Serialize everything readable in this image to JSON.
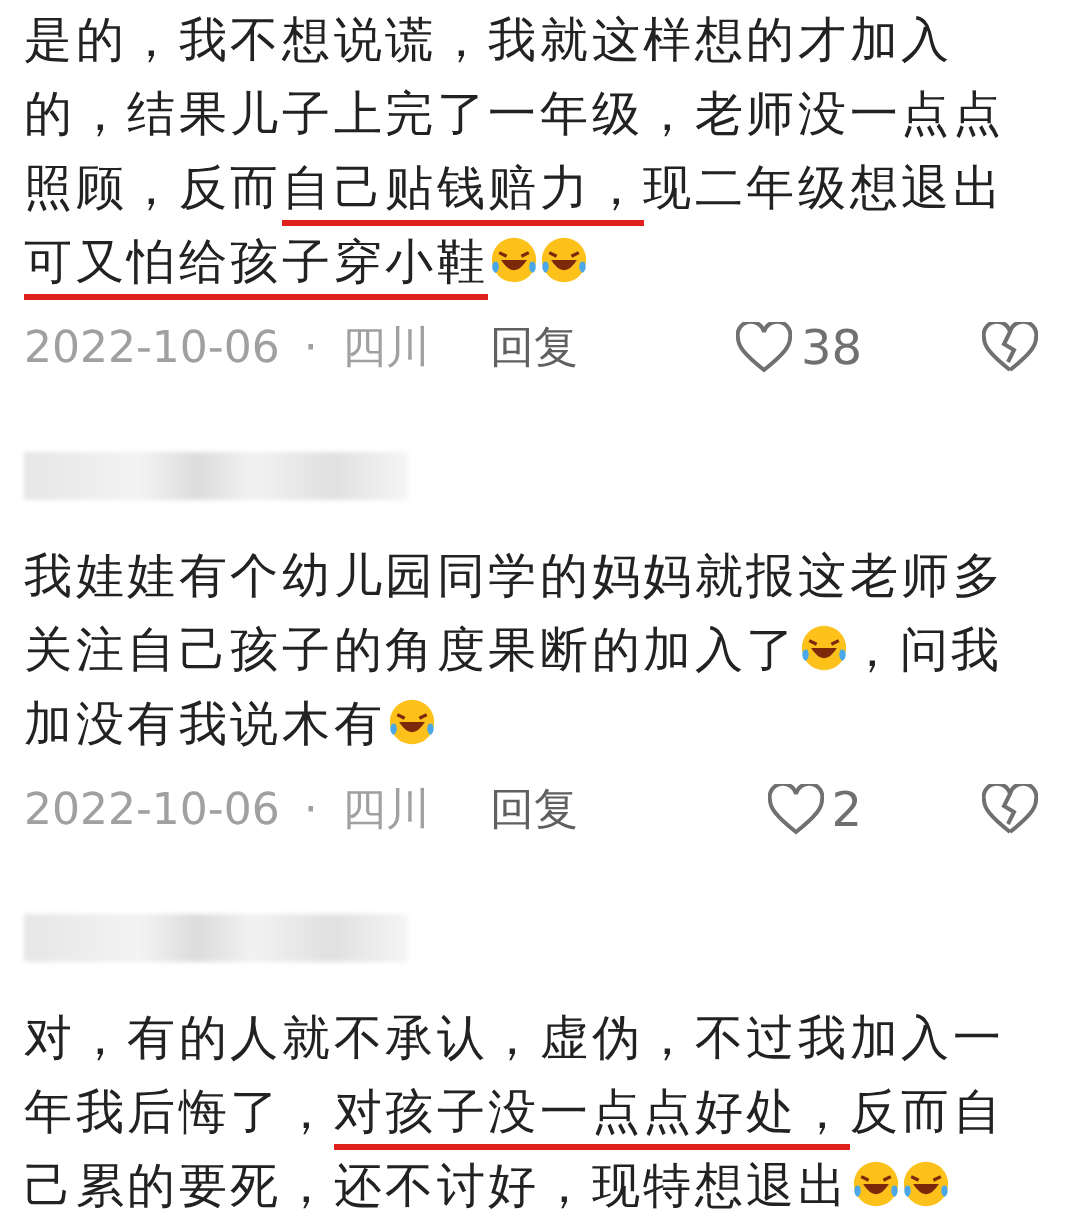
{
  "comments": [
    {
      "show_author": false,
      "lines": [
        [
          {
            "kind": "text",
            "text": "是的，我不想说谎，我就这样想的才加入",
            "underlined": false
          }
        ],
        [
          {
            "kind": "text",
            "text": "的，结果儿子上完了一年级，老师没一点点",
            "underlined": false
          }
        ],
        [
          {
            "kind": "text",
            "text": "照顾，反而",
            "underlined": false
          },
          {
            "kind": "text",
            "text": "自己贴钱赔力，",
            "underlined": true
          },
          {
            "kind": "text",
            "text": "现二年级想退出",
            "underlined": false
          }
        ],
        [
          {
            "kind": "text",
            "text": "可又怕给孩子穿小鞋",
            "underlined": true
          },
          {
            "kind": "emoji"
          },
          {
            "kind": "emoji"
          }
        ]
      ],
      "date": "2022-10-06",
      "separator": "·",
      "location": "四川",
      "reply": "回复",
      "likes": "38"
    },
    {
      "show_author": true,
      "lines": [
        [
          {
            "kind": "text",
            "text": "我娃娃有个幼儿园同学的妈妈就报这老师多",
            "underlined": false
          }
        ],
        [
          {
            "kind": "text",
            "text": "关注自己孩子的角度果断的加入了",
            "underlined": false
          },
          {
            "kind": "emoji"
          },
          {
            "kind": "text",
            "text": "，问我",
            "underlined": false
          }
        ],
        [
          {
            "kind": "text",
            "text": "加没有我说木有",
            "underlined": false
          },
          {
            "kind": "emoji"
          }
        ]
      ],
      "date": "2022-10-06",
      "separator": "·",
      "location": "四川",
      "reply": "回复",
      "likes": "2"
    },
    {
      "show_author": true,
      "lines": [
        [
          {
            "kind": "text",
            "text": "对，有的人就不承认，虚伪，不过我加入一",
            "underlined": false
          }
        ],
        [
          {
            "kind": "text",
            "text": "年我后悔了，",
            "underlined": false
          },
          {
            "kind": "text",
            "text": "对孩子没一点点好处，",
            "underlined": true
          },
          {
            "kind": "text",
            "text": "反而自",
            "underlined": false
          }
        ],
        [
          {
            "kind": "text",
            "text": "己累的要死，还不讨好，现特想退出",
            "underlined": false
          },
          {
            "kind": "emoji"
          },
          {
            "kind": "emoji"
          }
        ]
      ]
    }
  ]
}
